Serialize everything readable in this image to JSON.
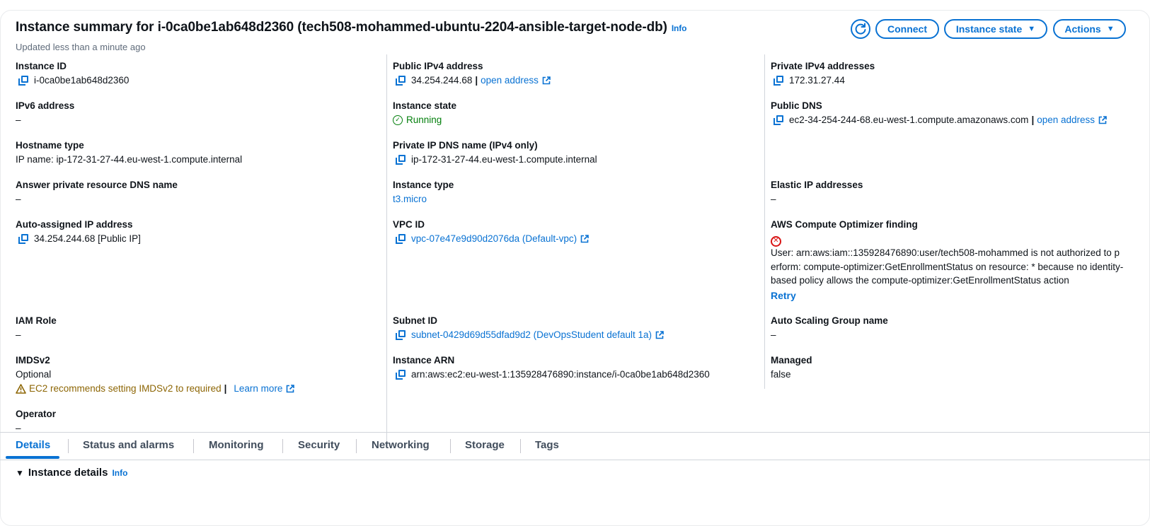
{
  "header": {
    "title": "Instance summary for i-0ca0be1ab648d2360 (tech508-mohammed-ubuntu-2204-ansible-target-node-db)",
    "info_label": "Info",
    "updated": "Updated less than a minute ago",
    "connect_label": "Connect",
    "instance_state_label": "Instance state",
    "actions_label": "Actions"
  },
  "fields": {
    "instance_id": {
      "label": "Instance ID",
      "value": "i-0ca0be1ab648d2360"
    },
    "public_ipv4": {
      "label": "Public IPv4 address",
      "value": "34.254.244.68",
      "link": "open address"
    },
    "private_ipv4": {
      "label": "Private IPv4 addresses",
      "value": "172.31.27.44"
    },
    "ipv6": {
      "label": "IPv6 address",
      "value": "–"
    },
    "instance_state": {
      "label": "Instance state",
      "value": "Running"
    },
    "public_dns": {
      "label": "Public DNS",
      "value": "ec2-34-254-244-68.eu-west-1.compute.amazonaws.com",
      "link": "open address"
    },
    "hostname_type": {
      "label": "Hostname type",
      "value": "IP name: ip-172-31-27-44.eu-west-1.compute.internal"
    },
    "private_ip_dns": {
      "label": "Private IP DNS name (IPv4 only)",
      "value": "ip-172-31-27-44.eu-west-1.compute.internal"
    },
    "answer_private_dns": {
      "label": "Answer private resource DNS name",
      "value": "–"
    },
    "instance_type": {
      "label": "Instance type",
      "value": "t3.micro"
    },
    "elastic_ip": {
      "label": "Elastic IP addresses",
      "value": "–"
    },
    "auto_assigned_ip": {
      "label": "Auto-assigned IP address",
      "value": "34.254.244.68 [Public IP]"
    },
    "vpc_id": {
      "label": "VPC ID",
      "value": "vpc-07e47e9d90d2076da (Default-vpc)"
    },
    "compute_optimizer": {
      "label": "AWS Compute Optimizer finding",
      "message": "User: arn:aws:iam::135928476890:user/tech508-mohammed is not authorized to perform: compute-optimizer:GetEnrollmentStatus on resource: * because no identity-based policy allows the compute-optimizer:GetEnrollmentStatus action",
      "retry": "Retry"
    },
    "iam_role": {
      "label": "IAM Role",
      "value": "–"
    },
    "subnet_id": {
      "label": "Subnet ID",
      "value": "subnet-0429d69d55dfad9d2 (DevOpsStudent default 1a)"
    },
    "asg_name": {
      "label": "Auto Scaling Group name",
      "value": "–"
    },
    "imdsv2": {
      "label": "IMDSv2",
      "value": "Optional",
      "warning": "EC2 recommends setting IMDSv2 to required",
      "learn_more": "Learn more"
    },
    "instance_arn": {
      "label": "Instance ARN",
      "value": "arn:aws:ec2:eu-west-1:135928476890:instance/i-0ca0be1ab648d2360"
    },
    "managed": {
      "label": "Managed",
      "value": "false"
    },
    "operator": {
      "label": "Operator",
      "value": "–"
    }
  },
  "tabs": [
    {
      "label": "Details",
      "active": true
    },
    {
      "label": "Status and alarms"
    },
    {
      "label": "Monitoring"
    },
    {
      "label": "Security"
    },
    {
      "label": "Networking"
    },
    {
      "label": "Storage"
    },
    {
      "label": "Tags"
    }
  ],
  "section": {
    "title": "Instance details",
    "info_label": "Info"
  },
  "colors": {
    "link": "#0972d3",
    "success": "#037f0c",
    "error": "#d91515",
    "warning": "#8d6605"
  }
}
